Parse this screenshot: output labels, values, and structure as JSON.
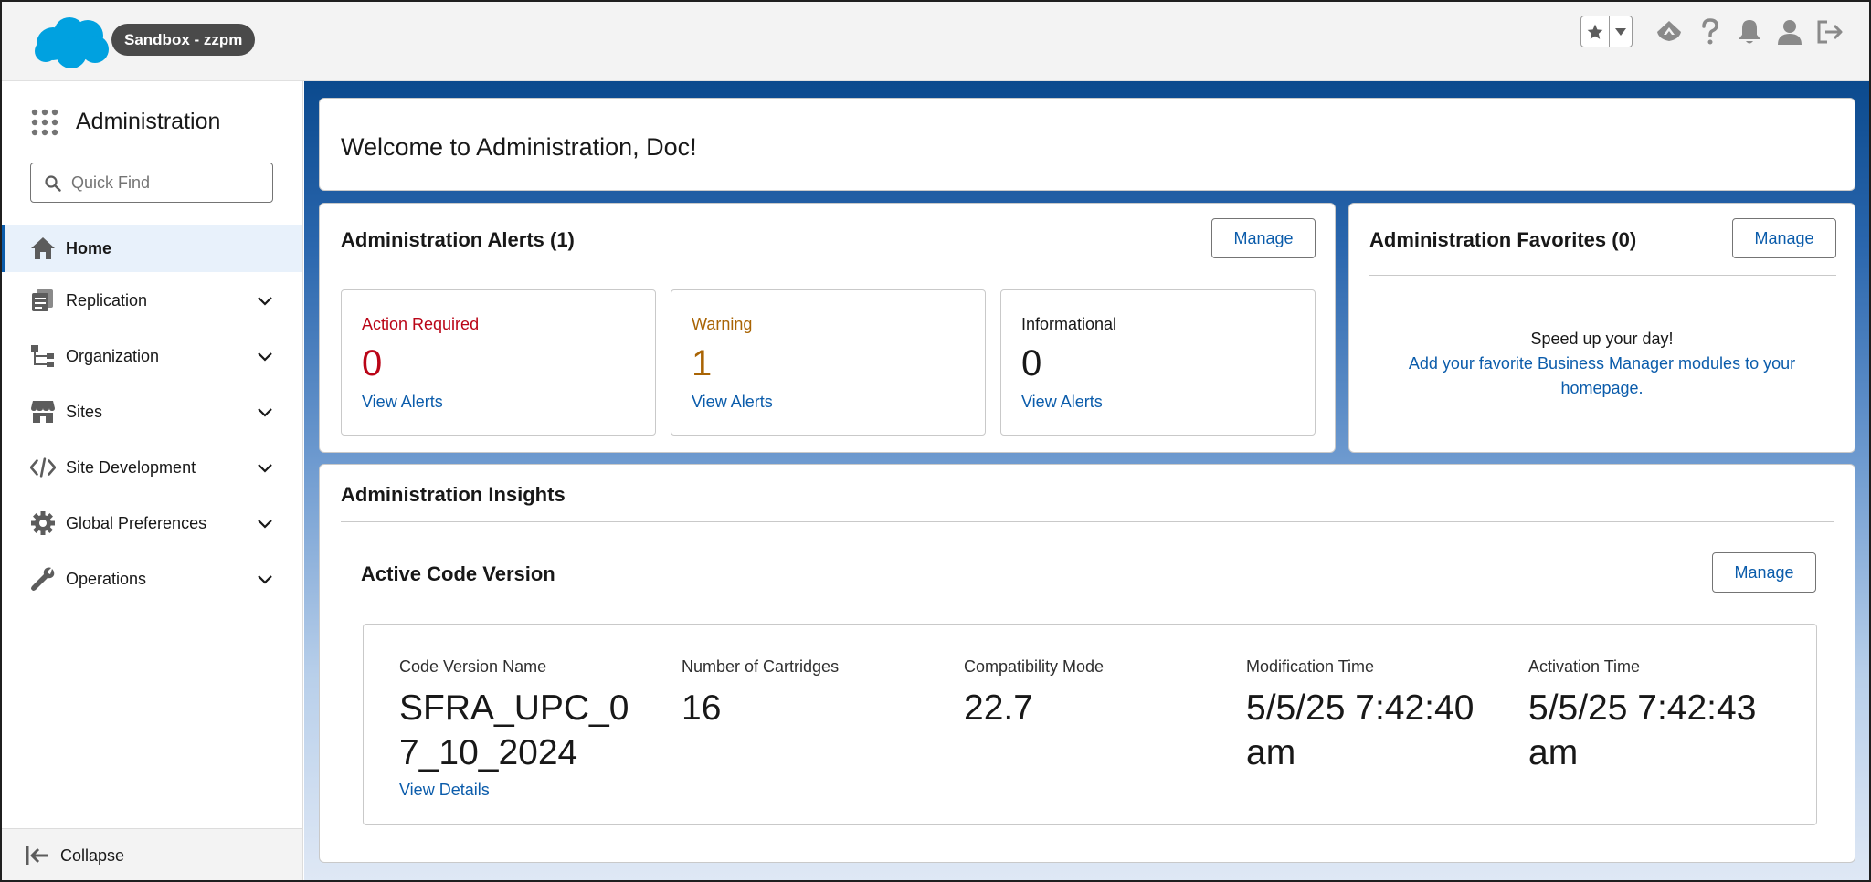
{
  "header": {
    "org_pill": "Sandbox - zzpm",
    "brand_color": "#00a1e0",
    "icons": [
      "favorites-star-icon",
      "favorites-dropdown-icon",
      "trailhead-icon",
      "help-icon",
      "notifications-bell-icon",
      "user-avatar-icon",
      "logout-icon"
    ]
  },
  "sidebar": {
    "app_title": "Administration",
    "search": {
      "placeholder": "Quick Find",
      "value": ""
    },
    "items": [
      {
        "label": "Home",
        "icon": "home-icon",
        "active": true
      },
      {
        "label": "Replication",
        "icon": "replication-icon"
      },
      {
        "label": "Organization",
        "icon": "organization-icon"
      },
      {
        "label": "Sites",
        "icon": "storefront-icon"
      },
      {
        "label": "Site Development",
        "icon": "code-icon"
      },
      {
        "label": "Global Preferences",
        "icon": "gear-icon"
      },
      {
        "label": "Operations",
        "icon": "wrench-icon"
      }
    ],
    "collapse_label": "Collapse"
  },
  "main": {
    "welcome": "Welcome to Administration, Doc!",
    "alerts": {
      "title": "Administration Alerts (1)",
      "manage_label": "Manage",
      "boxes": [
        {
          "label": "Action Required",
          "count": "0",
          "link": "View Alerts",
          "color": "#ba0517"
        },
        {
          "label": "Warning",
          "count": "1",
          "link": "View Alerts",
          "color": "#a96404"
        },
        {
          "label": "Informational",
          "count": "0",
          "link": "View Alerts",
          "color": "#181818"
        }
      ]
    },
    "favorites": {
      "title": "Administration Favorites (0)",
      "manage_label": "Manage",
      "message": "Speed up your day!",
      "link": "Add your favorite Business Manager modules to your homepage."
    },
    "insights": {
      "title": "Administration Insights",
      "code_version": {
        "title": "Active Code Version",
        "manage_label": "Manage",
        "fields": [
          {
            "label": "Code Version Name",
            "value": "SFRA_UPC_07_10_2024",
            "link": "View Details"
          },
          {
            "label": "Number of Cartridges",
            "value": "16"
          },
          {
            "label": "Compatibility Mode",
            "value": "22.7"
          },
          {
            "label": "Modification Time",
            "value": "5/5/25 7:42:40 am"
          },
          {
            "label": "Activation Time",
            "value": "5/5/25 7:42:43 am"
          }
        ]
      }
    }
  }
}
